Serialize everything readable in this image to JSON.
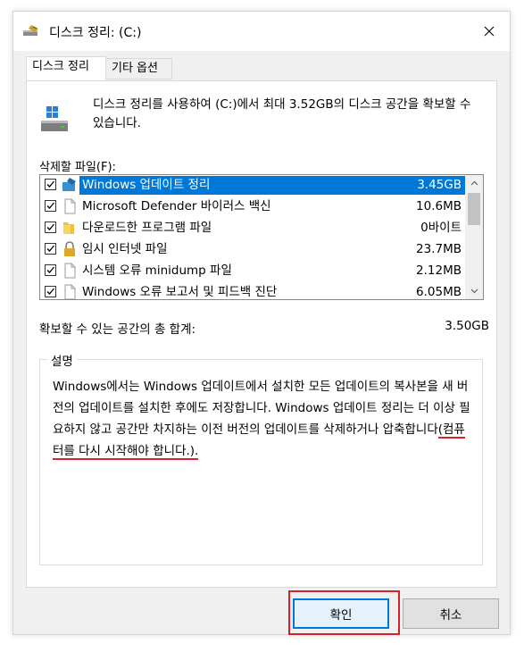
{
  "window": {
    "title": "디스크 정리: (C:)"
  },
  "tabs": [
    {
      "label": "디스크 정리",
      "active": true
    },
    {
      "label": "기타 옵션",
      "active": false
    }
  ],
  "intro": {
    "text": "디스크 정리를 사용하여 (C:)에서 최대 3.52GB의 디스크 공간을 확보할 수 있습니다."
  },
  "files": {
    "label": "삭제할 파일(F):",
    "items": [
      {
        "name": "Windows 업데이트 정리",
        "size": "3.45GB",
        "checked": true,
        "selected": true,
        "icon": "windows-update-icon"
      },
      {
        "name": "Microsoft Defender 바이러스 백신",
        "size": "10.6MB",
        "checked": true,
        "selected": false,
        "icon": "file-icon"
      },
      {
        "name": "다운로드한 프로그램 파일",
        "size": "0바이트",
        "checked": true,
        "selected": false,
        "icon": "folder-icon"
      },
      {
        "name": "임시 인터넷 파일",
        "size": "23.7MB",
        "checked": true,
        "selected": false,
        "icon": "lock-icon"
      },
      {
        "name": "시스템 오류 minidump 파일",
        "size": "2.12MB",
        "checked": true,
        "selected": false,
        "icon": "file-icon"
      },
      {
        "name": "Windows 오류 보고서 및 피드백 진단",
        "size": "6.05MB",
        "checked": true,
        "selected": false,
        "icon": "file-icon"
      }
    ]
  },
  "total": {
    "label": "확보할 수 있는 공간의 총 합계:",
    "value": "3.50GB"
  },
  "description": {
    "title": "설명",
    "text_main": "Windows에서는 Windows 업데이트에서 설치한 모든 업데이트의 복사본을 새 버전의 업데이트를 설치한 후에도 저장합니다. Windows 업데이트 정리는 더 이상 필요하지 않고 공간만 차지하는 이전 버전의 업데이트를 삭제하거나 압축합니다",
    "text_highlight": "(컴퓨터를 다시 시작해야 합니다.)."
  },
  "buttons": {
    "ok": "확인",
    "cancel": "취소"
  },
  "colors": {
    "selection": "#0078d7",
    "annotation": "#d6202c"
  }
}
